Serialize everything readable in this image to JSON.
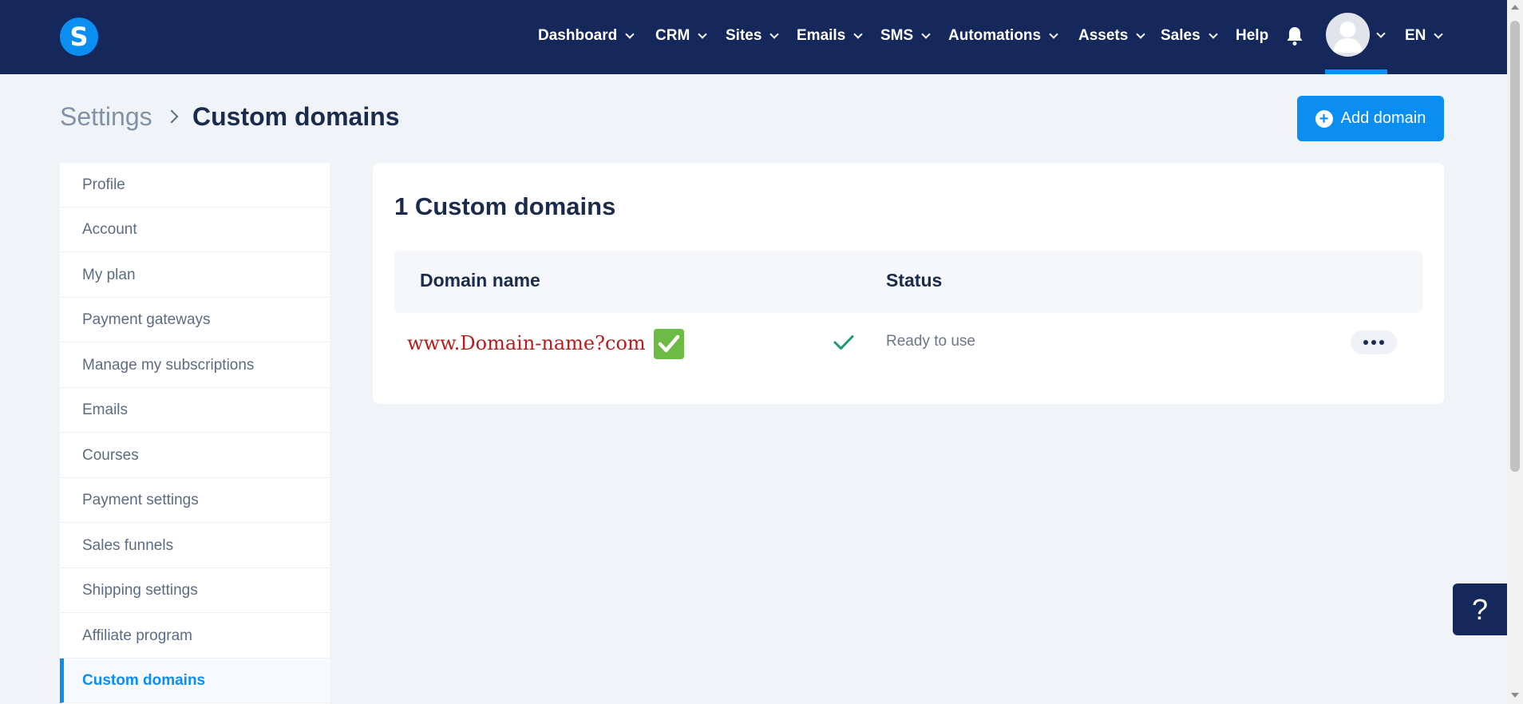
{
  "brand": {
    "logo_letter": "S",
    "accent_color": "#0b8ef2",
    "nav_bg": "#14285c"
  },
  "nav": {
    "items": [
      {
        "label": "Dashboard"
      },
      {
        "label": "CRM"
      },
      {
        "label": "Sites"
      },
      {
        "label": "Emails"
      },
      {
        "label": "SMS"
      },
      {
        "label": "Automations"
      },
      {
        "label": "Assets"
      },
      {
        "label": "Sales"
      },
      {
        "label": "Help"
      }
    ],
    "notifications_icon": "bell-icon",
    "avatar_icon": "user-avatar-icon",
    "language": "EN"
  },
  "breadcrumb": {
    "parent": "Settings",
    "current": "Custom domains"
  },
  "actions": {
    "add_domain": "Add domain"
  },
  "sidebar": {
    "items": [
      {
        "label": "Profile"
      },
      {
        "label": "Account"
      },
      {
        "label": "My plan"
      },
      {
        "label": "Payment gateways"
      },
      {
        "label": "Manage my subscriptions"
      },
      {
        "label": "Emails"
      },
      {
        "label": "Courses"
      },
      {
        "label": "Payment settings"
      },
      {
        "label": "Sales funnels"
      },
      {
        "label": "Shipping settings"
      },
      {
        "label": "Affiliate program"
      },
      {
        "label": "Custom domains",
        "active": true
      }
    ]
  },
  "main": {
    "title": "1 Custom domains",
    "columns": {
      "domain": "Domain name",
      "status": "Status"
    },
    "rows": [
      {
        "domain": "www.Domain-name?com",
        "status": "Ready to use",
        "status_color": "#1c9a6c"
      }
    ]
  },
  "help": {
    "label": "?"
  }
}
